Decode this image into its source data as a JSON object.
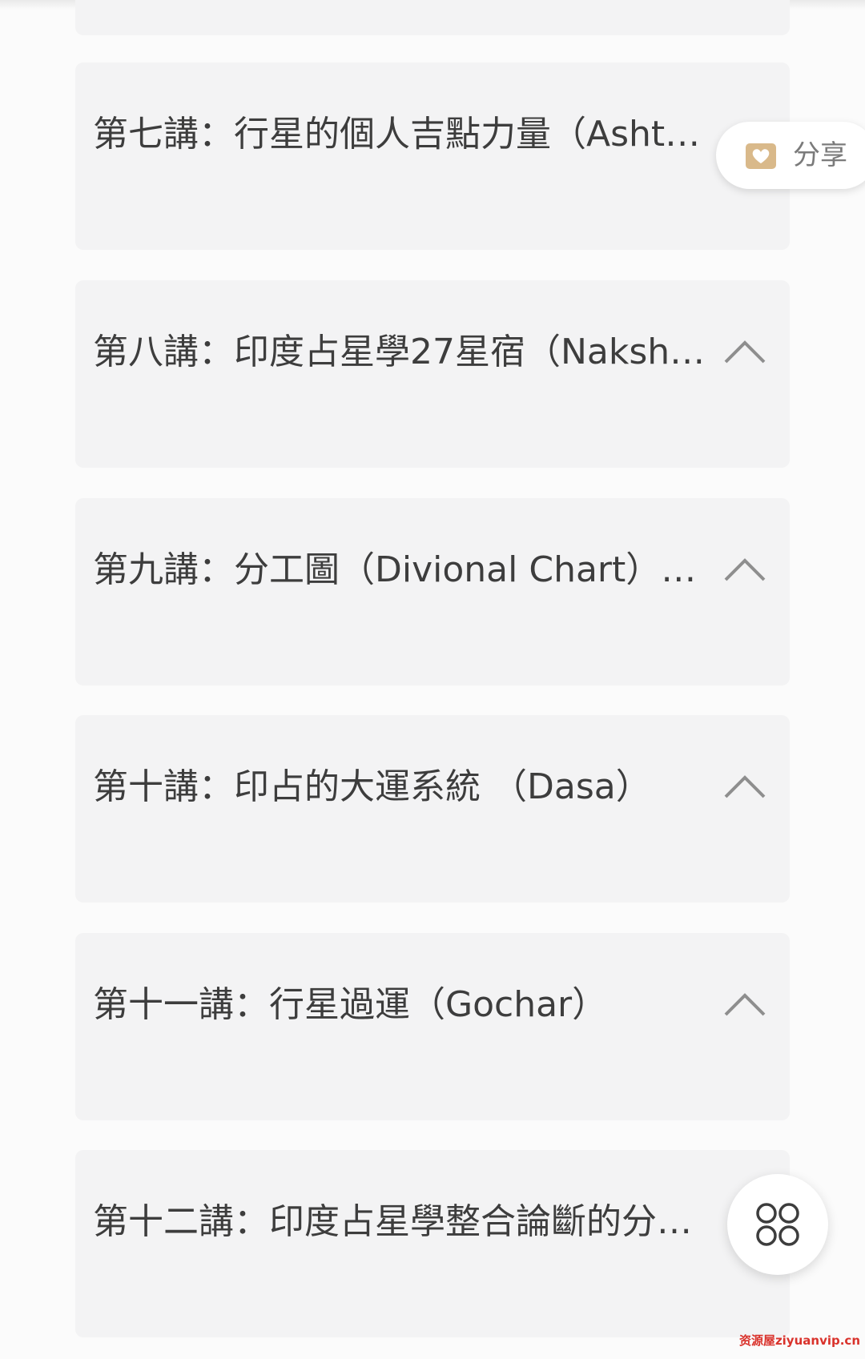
{
  "lectures": [
    {
      "title": "第七講：行星的個人吉點力量（Asht…"
    },
    {
      "title": "第八講：印度占星學27星宿（Naksh…"
    },
    {
      "title": "第九講：分工圖（Divional Chart）的…"
    },
    {
      "title": "第十講：印占的大運系統 （Dasa）"
    },
    {
      "title": "第十一講：行星過運（Gochar）"
    },
    {
      "title": "第十二講：印度占星學整合論斷的分…"
    }
  ],
  "share": {
    "label": "分享",
    "icon": "share-heart-icon",
    "icon_color": "#d9b98a"
  },
  "fab": {
    "icon": "four-circles-menu-icon"
  },
  "watermark": "资源屋ziyuanvip.cn",
  "colors": {
    "card": "#f3f3f4",
    "background": "#fbfbfb",
    "text": "#3d3d3d",
    "chevron": "#8e8e8e"
  }
}
